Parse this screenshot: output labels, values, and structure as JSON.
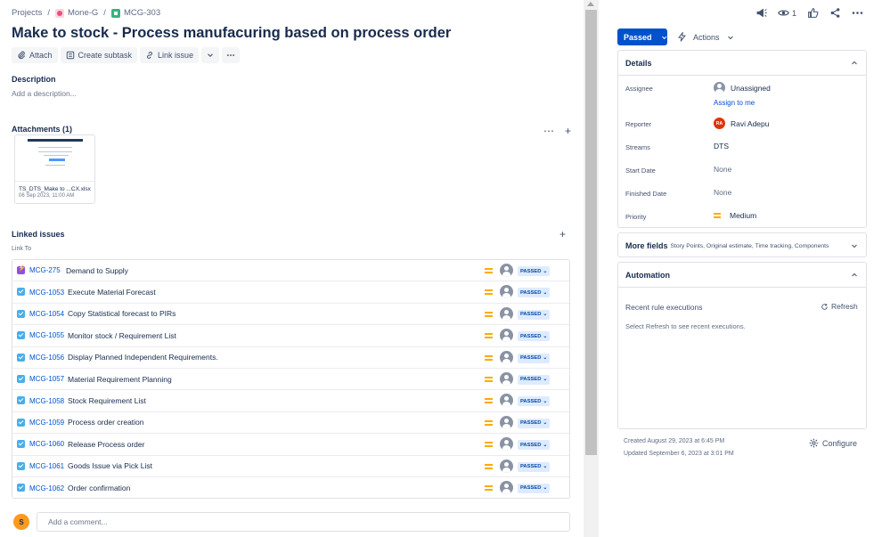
{
  "breadcrumb": {
    "projects": "Projects",
    "sep": "/",
    "project": "Mone-G",
    "issue_key": "MCG-303"
  },
  "issue": {
    "title": "Make to stock - Process manufacuring based on process order"
  },
  "toolbar": {
    "attach": "Attach",
    "create_subtask": "Create subtask",
    "link_issue": "Link issue"
  },
  "description": {
    "label": "Description",
    "placeholder": "Add a description..."
  },
  "attachments": {
    "label": "Attachments (1)",
    "file_name": "TS_DTS_Make to ...CX.xlsx",
    "file_date": "06 Sep 2023, 11:00 AM"
  },
  "linked": {
    "label": "Linked issues",
    "relation": "Link To",
    "items": [
      {
        "key": "MCG-275",
        "summary": "Demand to Supply",
        "status": "PASSED",
        "type": "epic"
      },
      {
        "key": "MCG-1053",
        "summary": "Execute Material Forecast",
        "status": "PASSED",
        "type": "task"
      },
      {
        "key": "MCG-1054",
        "summary": "Copy Statistical forecast to PIRs",
        "status": "PASSED",
        "type": "task"
      },
      {
        "key": "MCG-1055",
        "summary": "Monitor stock / Requirement List",
        "status": "PASSED",
        "type": "task"
      },
      {
        "key": "MCG-1056",
        "summary": "Display Planned Independent Requirements.",
        "status": "PASSED",
        "type": "task"
      },
      {
        "key": "MCG-1057",
        "summary": "Material Requirement Planning",
        "status": "PASSED",
        "type": "task"
      },
      {
        "key": "MCG-1058",
        "summary": "Stock Requirement List",
        "status": "PASSED",
        "type": "task"
      },
      {
        "key": "MCG-1059",
        "summary": "Process order creation",
        "status": "PASSED",
        "type": "task"
      },
      {
        "key": "MCG-1060",
        "summary": "Release Process order",
        "status": "PASSED",
        "type": "task"
      },
      {
        "key": "MCG-1061",
        "summary": "Goods Issue via Pick List",
        "status": "PASSED",
        "type": "task"
      },
      {
        "key": "MCG-1062",
        "summary": "Order confirmation",
        "status": "PASSED",
        "type": "task"
      }
    ]
  },
  "comment": {
    "avatar_initial": "S",
    "placeholder": "Add a comment..."
  },
  "header_actions": {
    "watch_count": "1"
  },
  "status_button": "Passed",
  "actions_button": "Actions",
  "details": {
    "title": "Details",
    "assignee_label": "Assignee",
    "assignee_value": "Unassigned",
    "assign_to_me": "Assign to me",
    "reporter_label": "Reporter",
    "reporter_initials": "RA",
    "reporter_value": "Ravi Adepu",
    "streams_label": "Streams",
    "streams_value": "DTS",
    "start_label": "Start Date",
    "start_value": "None",
    "finished_label": "Finished Date",
    "finished_value": "None",
    "priority_label": "Priority",
    "priority_value": "Medium"
  },
  "more_fields": {
    "title": "More fields",
    "subtitle": "Story Points, Original estimate, Time tracking, Components"
  },
  "automation": {
    "title": "Automation",
    "recent": "Recent rule executions",
    "refresh": "Refresh",
    "hint": "Select Refresh to see recent executions."
  },
  "meta": {
    "created": "Created August 29, 2023 at 6:45 PM",
    "updated": "Updated September 6, 2023 at 3:01 PM",
    "configure": "Configure"
  },
  "colors": {
    "primary": "#0052cc",
    "link": "#0052cc",
    "priority_medium": "#ffab00",
    "status_badge_bg": "#deebff",
    "status_badge_text": "#0747a6"
  }
}
